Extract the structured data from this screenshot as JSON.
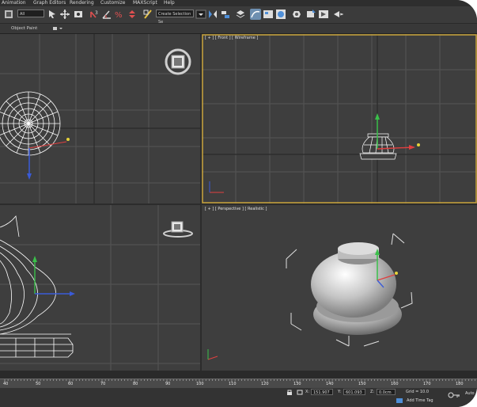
{
  "menu": {
    "items": [
      "Animation",
      "Graph Editors",
      "Rendering",
      "Customize",
      "MAXScript",
      "Help"
    ]
  },
  "toolbar": {
    "selection_filter": "All",
    "named_selection": "Create Selection Se"
  },
  "ribbon": {
    "label": "Object Paint"
  },
  "viewports": {
    "top_left": {
      "label": ""
    },
    "front": {
      "label": "[ + ] [ Front ] [ Wireframe ]"
    },
    "bottom_left": {
      "label": ""
    },
    "perspective": {
      "label": "[ + ] [ Perspective ] [ Realistic ]"
    }
  },
  "timeline": {
    "ticks": [
      "40",
      "50",
      "60",
      "70",
      "80",
      "90",
      "100",
      "110",
      "120",
      "130",
      "140",
      "150",
      "160",
      "170",
      "180"
    ]
  },
  "status": {
    "x_label": "X:",
    "x_value": "151.907",
    "y_label": "Y:",
    "y_value": "601.093",
    "z_label": "Z:",
    "z_value": "0.0cm",
    "grid": "Grid = 10.0",
    "add_time_tag": "Add Time Tag",
    "auto": "Auto"
  },
  "colors": {
    "active_border": "#c9a33a",
    "viewport_bg": "#3e3e3e",
    "grid": "#555555"
  }
}
